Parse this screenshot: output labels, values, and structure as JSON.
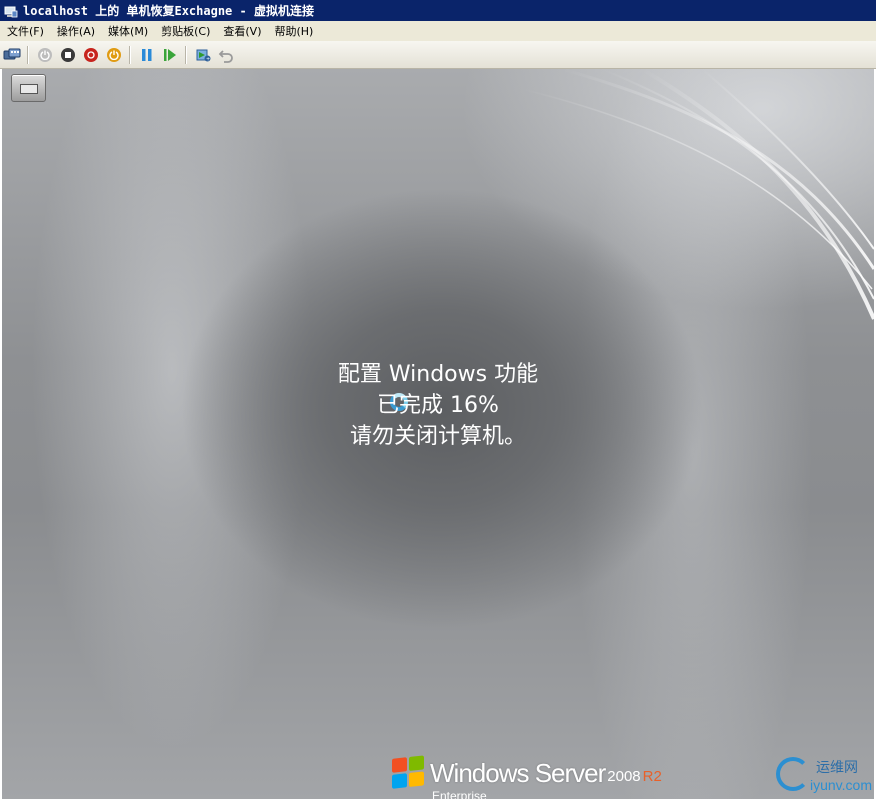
{
  "window": {
    "title": "localhost 上的 单机恢复Exchagne - 虚拟机连接"
  },
  "menubar": {
    "items": [
      {
        "label": "文件(F)"
      },
      {
        "label": "操作(A)"
      },
      {
        "label": "媒体(M)"
      },
      {
        "label": "剪贴板(C)"
      },
      {
        "label": "查看(V)"
      },
      {
        "label": "帮助(H)"
      }
    ]
  },
  "toolbar": {
    "icons": [
      "ctrl-alt-del-icon",
      "start-icon",
      "turn-off-icon",
      "shut-down-icon",
      "save-state-icon",
      "pause-icon",
      "reset-icon",
      "snapshot-icon",
      "revert-icon"
    ]
  },
  "screen": {
    "status_line1": "配置 Windows 功能",
    "status_line2": "已完成 16%",
    "status_line3": "请勿关闭计算机。",
    "progress_percent": 16,
    "brand_name": "Windows Server",
    "brand_version": "2008",
    "brand_r2": "R2",
    "brand_edition": "Enterprise"
  },
  "watermark": {
    "line1": "运维网",
    "line2": "iyunv.com"
  },
  "colors": {
    "titlebar": "#0a246a",
    "menubar": "#ece9d8",
    "spinner": "#3a9bd1",
    "r2_accent": "#e8612a"
  }
}
